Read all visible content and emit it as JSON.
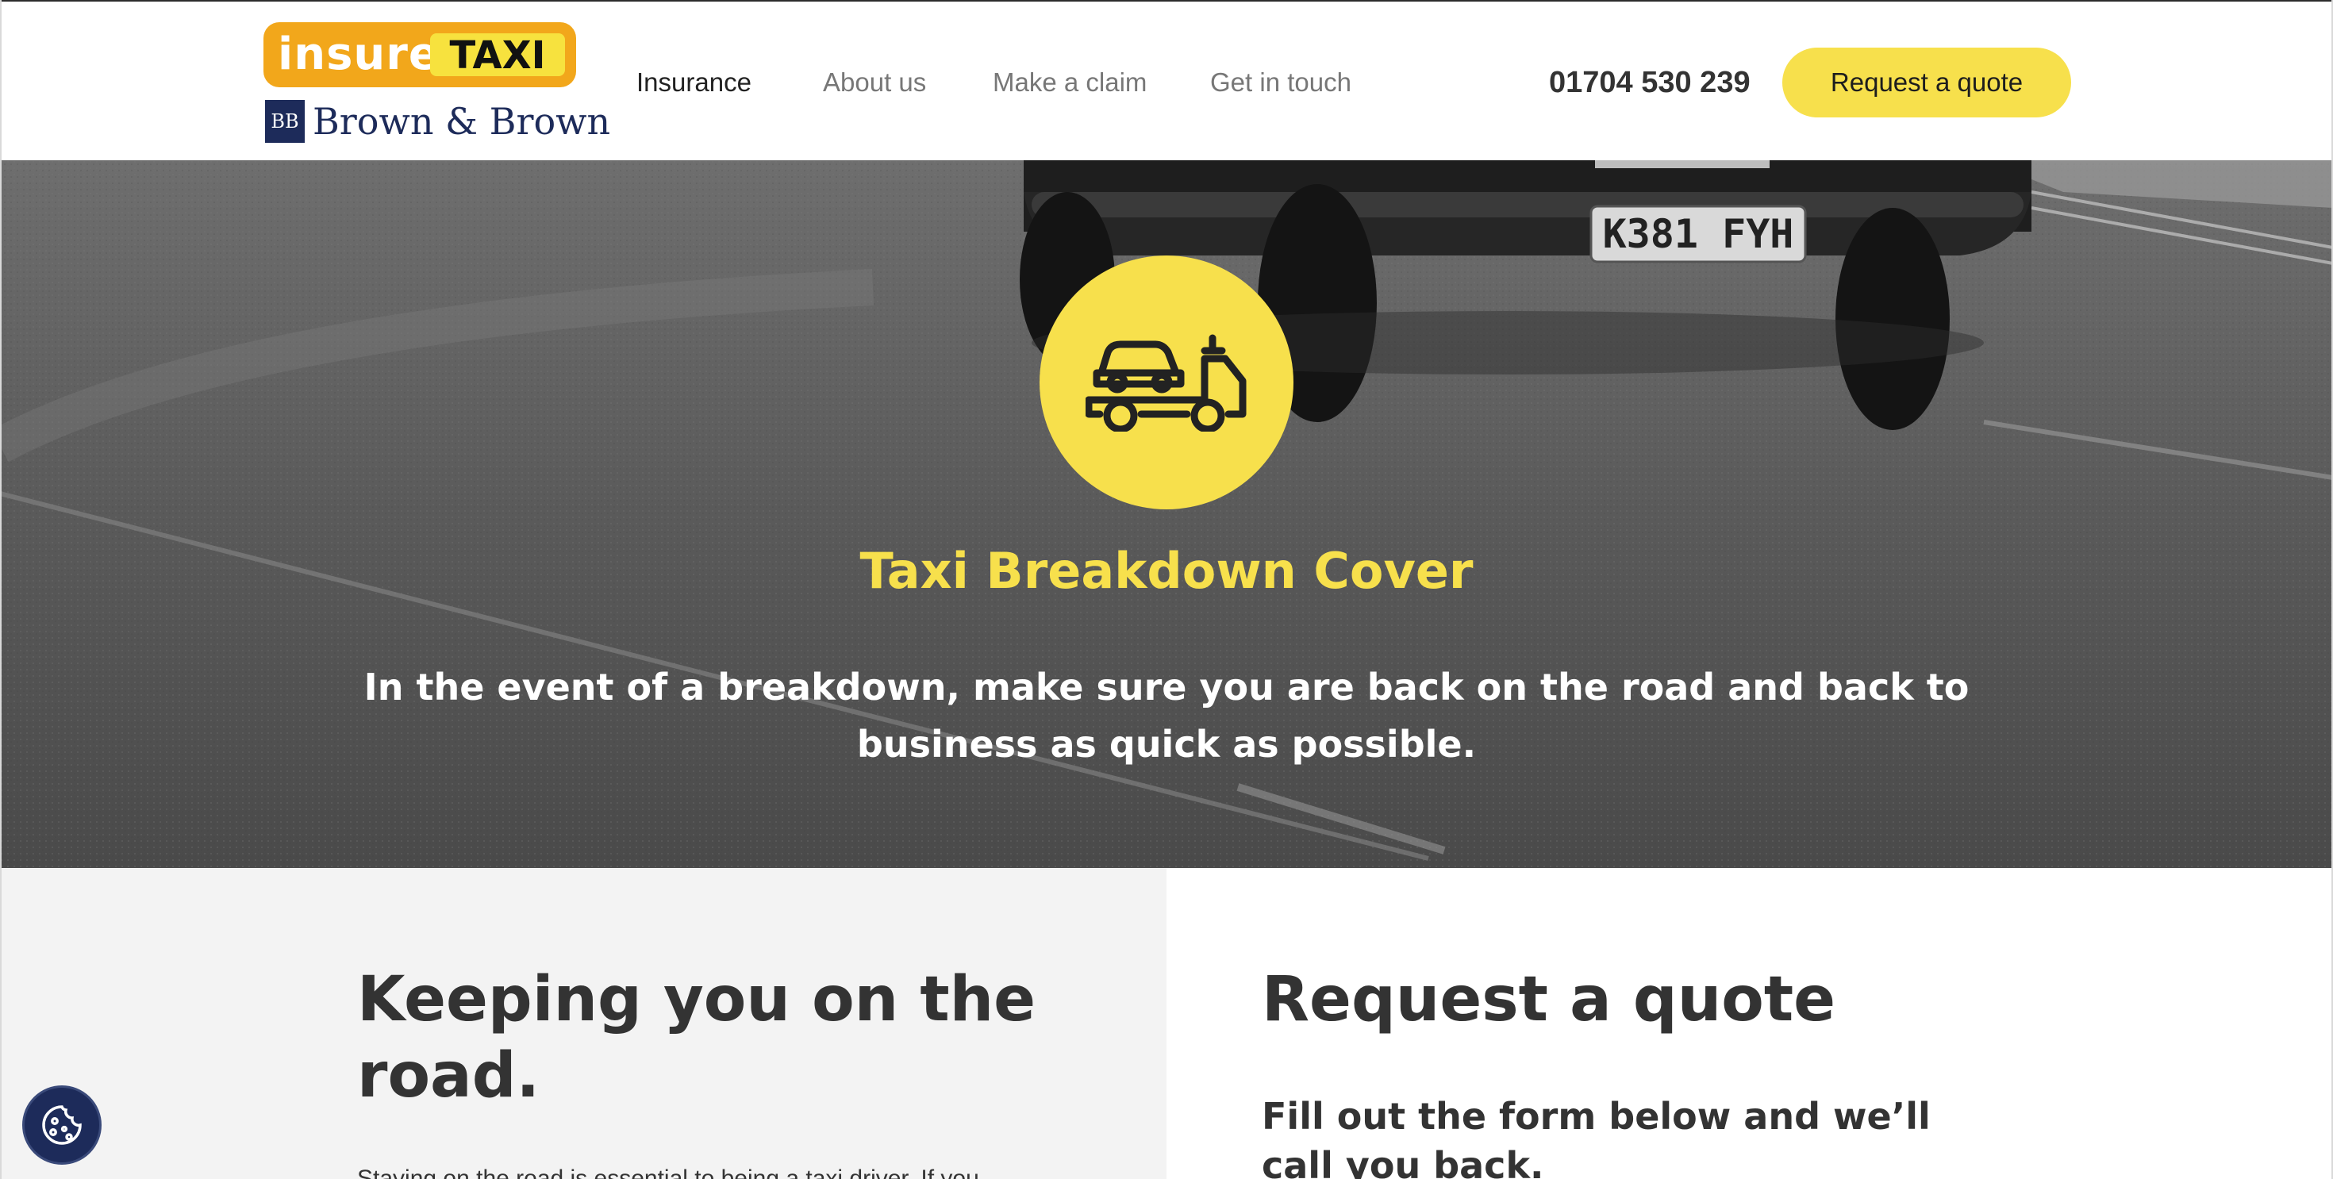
{
  "header": {
    "logo": {
      "insure": "insure",
      "taxi": "TAXI",
      "bb_mark": "BB",
      "bb_text": "Brown & Brown"
    },
    "nav": [
      {
        "label": "Insurance",
        "active": true
      },
      {
        "label": "About us",
        "active": false
      },
      {
        "label": "Make a claim",
        "active": false
      },
      {
        "label": "Get in touch",
        "active": false
      }
    ],
    "phone": "01704 530 239",
    "cta_label": "Request a quote"
  },
  "hero": {
    "plate": "K381 FYH",
    "icon": "tow-truck-icon",
    "title": "Taxi Breakdown Cover",
    "subtitle": "In the event of a breakdown, make sure you are back on the road and back to business as quick as possible."
  },
  "left_section": {
    "heading": "Keeping you on the road.",
    "body": "Staying on the road is essential to being a taxi driver. If you"
  },
  "right_section": {
    "heading": "Request a quote",
    "subheading": "Fill out the form below and we’ll call you back."
  },
  "cookie_button": {
    "icon": "cookie-icon"
  },
  "colors": {
    "accent_yellow": "#f7e04c",
    "logo_orange": "#f2a71b",
    "brand_navy": "#1d2b5a",
    "text_dark": "#333333"
  }
}
